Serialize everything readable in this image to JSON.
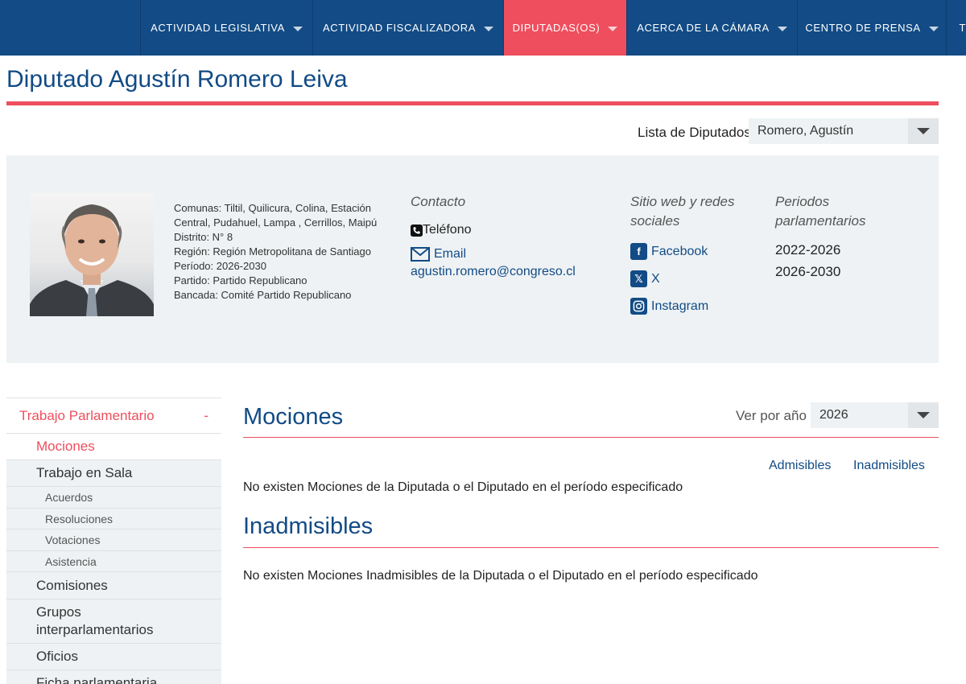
{
  "nav": {
    "items": [
      {
        "label": "ACTIVIDAD LEGISLATIVA"
      },
      {
        "label": "ACTIVIDAD FISCALIZADORA"
      },
      {
        "label": "DIPUTADAS(OS)"
      },
      {
        "label": "ACERCA DE LA CÁMARA"
      },
      {
        "label": "CENTRO DE PRENSA"
      },
      {
        "label": "T"
      }
    ]
  },
  "page": {
    "title": "Diputado Agustín Romero Leiva"
  },
  "lista": {
    "label": "Lista de Diputados",
    "selected": "Romero, Agustín"
  },
  "profile": {
    "info": {
      "comunas": "Comunas: Tiltil, Quilicura, Colina, Estación Central, Pudahuel, Lampa , Cerrillos, Maipú",
      "distrito": "Distrito: N° 8",
      "region": "Región: Región Metropolitana de Santiago",
      "periodo": "Período: 2026-2030",
      "partido": "Partido: Partido Republicano",
      "bancada": "Bancada: Comité Partido Republicano"
    },
    "contact": {
      "heading": "Contacto",
      "phone_label": "Teléfono",
      "email_label": "Email",
      "email": "agustin.romero@congreso.cl"
    },
    "social": {
      "heading": "Sitio web y redes sociales",
      "facebook": "Facebook",
      "x": "X",
      "instagram": "Instagram"
    },
    "periods": {
      "heading": "Periodos parlamentarios",
      "items": [
        "2022-2026",
        "2026-2030"
      ]
    }
  },
  "sidebar": {
    "head": "Trabajo Parlamentario",
    "head_toggle": "-",
    "items": [
      {
        "label": "Mociones"
      },
      {
        "label": "Trabajo en Sala"
      },
      {
        "label": "Acuerdos"
      },
      {
        "label": "Resoluciones"
      },
      {
        "label": "Votaciones"
      },
      {
        "label": "Asistencia"
      },
      {
        "label": "Comisiones"
      },
      {
        "label": "Grupos interparlamentarios"
      },
      {
        "label": "Oficios"
      },
      {
        "label": "Ficha parlamentaria"
      }
    ]
  },
  "main": {
    "mociones_title": "Mociones",
    "ver_label": "Ver por año",
    "year": "2026",
    "tabs": {
      "admisibles": "Admisibles",
      "inadmisibles": "Inadmisibles"
    },
    "mociones_empty": "No existen Mociones de la Diputada o el Diputado en el período especificado",
    "inadmisibles_title": "Inadmisibles",
    "inadmisibles_empty": "No existen Mociones Inadmisibles de la Diputada o el Diputado en el período especificado"
  },
  "colors": {
    "brand_blue": "#124b85",
    "accent_red": "#ee4e5d",
    "panel_gray": "#eef2f4"
  }
}
